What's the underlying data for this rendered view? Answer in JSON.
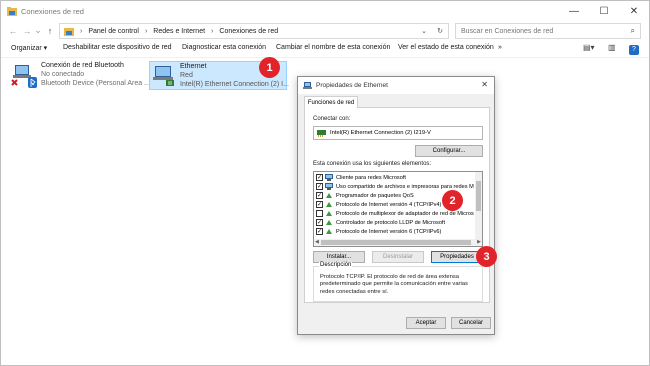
{
  "window": {
    "title": "Conexiones de red"
  },
  "controls": {
    "minimize": "—",
    "maximize": "☐",
    "close": "✕"
  },
  "nav": {
    "back": "←",
    "forward": "→",
    "dropdown": "⌄",
    "up": "↑"
  },
  "address": {
    "crumbs": [
      "Panel de control",
      "Redes e Internet",
      "Conexiones de red"
    ],
    "sep": "›",
    "dropdown": "⌄",
    "refresh": "↻"
  },
  "search": {
    "placeholder": "Buscar en Conexiones de red",
    "icon": "⌕"
  },
  "toolbar": {
    "organize": "Organizar ▾",
    "disable": "Deshabilitar este dispositivo de red",
    "diagnose": "Diagnosticar esta conexión",
    "rename": "Cambiar el nombre de esta conexión",
    "status": "Ver el estado de esta conexión",
    "more": "»",
    "view_icon": "▤▾",
    "pane_icon": "▥",
    "help_icon": "?"
  },
  "connections": [
    {
      "name": "Conexión de red Bluetooth",
      "status": "No conectado",
      "device": "Bluetooth Device (Personal Area ..."
    },
    {
      "name": "Ethernet",
      "status": "Red",
      "device": "Intel(R) Ethernet Connection (2) I..."
    }
  ],
  "badges": [
    "1",
    "2",
    "3"
  ],
  "dialog": {
    "title": "Propiedades de Ethernet",
    "close": "✕",
    "tab": "Funciones de red",
    "connect_label": "Conectar con:",
    "adapter": "Intel(R) Ethernet Connection (2) I219-V",
    "configure": "Configurar...",
    "uses_label": "Esta conexión usa los siguientes elementos:",
    "items": [
      {
        "label": "Cliente para redes Microsoft",
        "check": "✓"
      },
      {
        "label": "Uso compartido de archivos e impresoras para redes M",
        "check": "✓"
      },
      {
        "label": "Programador de paquetes QoS",
        "check": "✓"
      },
      {
        "label": "Protocolo de Internet versión 4 (TCP/IPv4)",
        "check": "✓"
      },
      {
        "label": "Protocolo de multiplexor de adaptador de red de Micros",
        "check": ""
      },
      {
        "label": "Controlador de protocolo LLDP de Microsoft",
        "check": "✓"
      },
      {
        "label": "Protocolo de Internet versión 6 (TCP/IPv6)",
        "check": "✓"
      }
    ],
    "install": "Instalar...",
    "uninstall": "Desinstalar",
    "properties": "Propiedades",
    "description_label": "Descripción",
    "description": "Protocolo TCP/IP. El protocolo de red de área extensa predeterminado que permite la comunicación entre varias redes conectadas entre sí.",
    "accept": "Aceptar",
    "cancel": "Cancelar"
  },
  "colors": {
    "accent": "#0078d7",
    "badge": "#e0242a",
    "selection": "#cce8ff"
  }
}
